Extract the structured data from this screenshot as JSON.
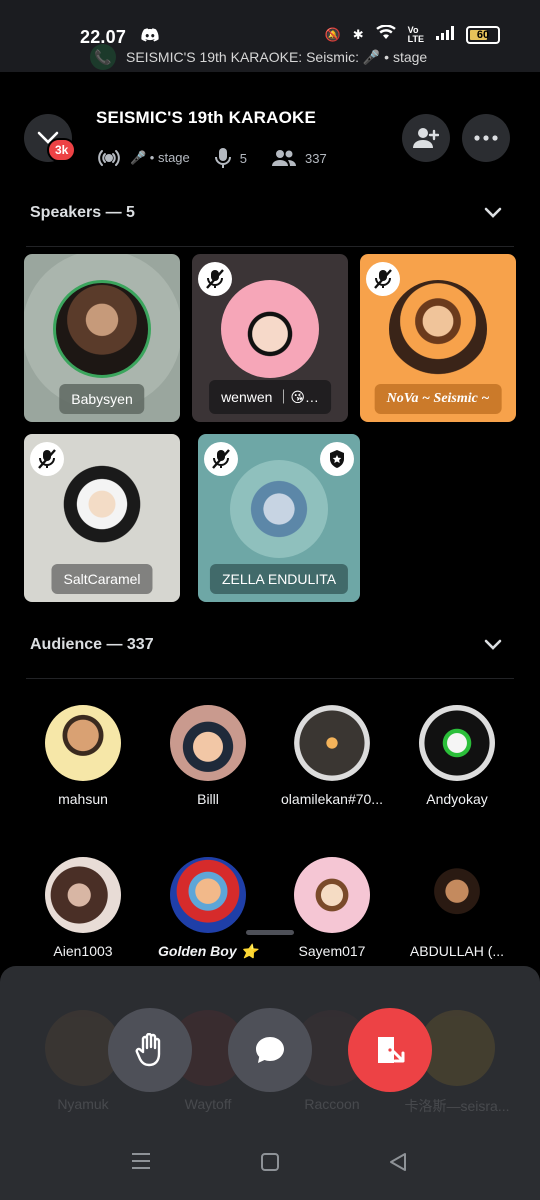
{
  "status_bar": {
    "time": "22.07",
    "battery": "60",
    "notification": "SEISMIC'S 19th KARAOKE: Seismic: 🎤 • stage"
  },
  "header": {
    "badge": "3k",
    "title": "SEISMIC'S 19th KARAOKE",
    "meta_stage": "🎤 • stage",
    "speakers_count": "5",
    "listeners_count": "337"
  },
  "speakers_section": {
    "title": "Speakers — 5"
  },
  "speakers": [
    {
      "name": "Babysyen",
      "muted": false,
      "bg": "#9aa69e"
    },
    {
      "name": "wenwen ｜😘…",
      "muted": true,
      "bg": "#3b3436"
    },
    {
      "name": "NoVa ~ Seismic ~",
      "muted": true,
      "bg": "#f7a24b"
    },
    {
      "name": "SaltCaramel",
      "muted": true,
      "bg": "#d6d6d0"
    },
    {
      "name": "ZELLA ENDULITA",
      "muted": true,
      "moderator": true,
      "bg": "#6ea7a6"
    }
  ],
  "audience_section": {
    "title": "Audience — 337"
  },
  "audience": [
    {
      "name": "mahsun"
    },
    {
      "name": "Billl"
    },
    {
      "name": "olamilekan#70..."
    },
    {
      "name": "Andyokay"
    },
    {
      "name": "Aien1003"
    },
    {
      "name": "Golden Boy ⭐"
    },
    {
      "name": "Sayem017"
    },
    {
      "name": "ABDULLAH (..."
    }
  ],
  "ghost_audience": [
    {
      "name": "Nyamuk"
    },
    {
      "name": "Waytoff"
    },
    {
      "name": "Raccoon"
    },
    {
      "name": "卡洛斯—seisra..."
    }
  ],
  "colors": {
    "background": "#000000",
    "surface": "#2b2d31",
    "danger": "#ed4245",
    "speaking_ring": "#3ba55d"
  }
}
